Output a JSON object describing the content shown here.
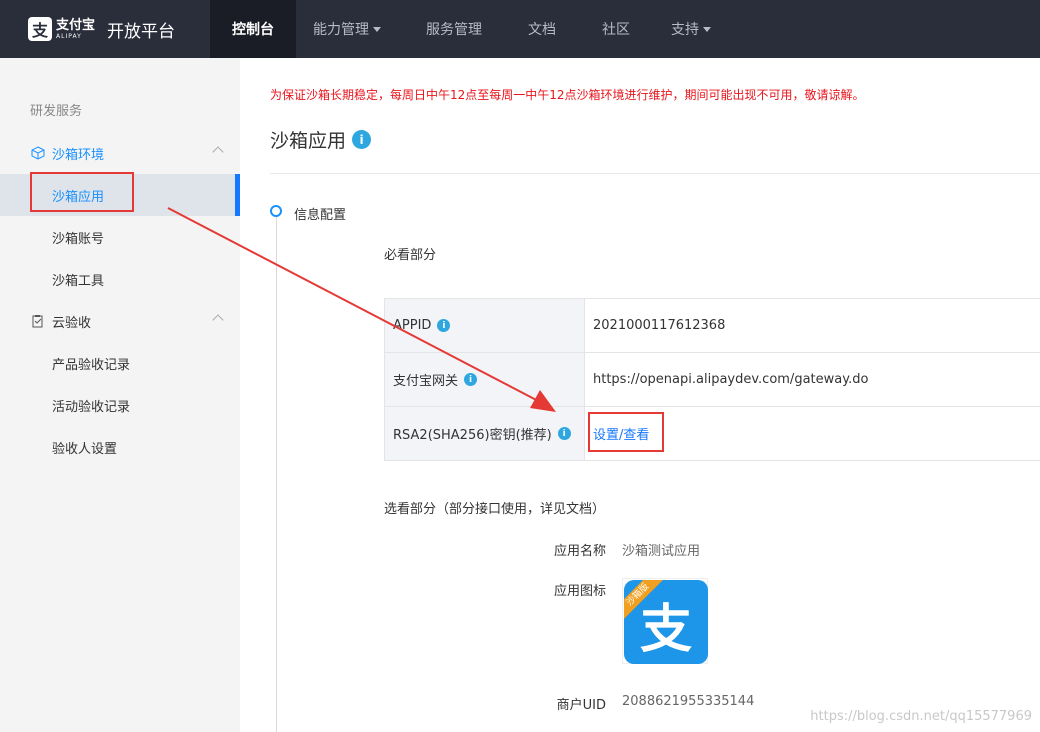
{
  "brand": {
    "logo_glyph": "支",
    "logo_cn": "支付宝",
    "logo_en": "ALIPAY",
    "title": "开放平台"
  },
  "nav": [
    {
      "label": "控制台",
      "active": true,
      "dropdown": false
    },
    {
      "label": "能力管理",
      "active": false,
      "dropdown": true
    },
    {
      "label": "服务管理",
      "active": false,
      "dropdown": false
    },
    {
      "label": "文档",
      "active": false,
      "dropdown": false
    },
    {
      "label": "社区",
      "active": false,
      "dropdown": false
    },
    {
      "label": "支持",
      "active": false,
      "dropdown": true
    }
  ],
  "sidebar": {
    "section": "研发服务",
    "group1": {
      "label": "沙箱环境",
      "icon": "cube-icon"
    },
    "group1_items": [
      "沙箱应用",
      "沙箱账号",
      "沙箱工具"
    ],
    "group2": {
      "label": "云验收",
      "icon": "clipboard-icon"
    },
    "group2_items": [
      "产品验收记录",
      "活动验收记录",
      "验收人设置"
    ]
  },
  "main": {
    "notice": "为保证沙箱长期稳定，每周日中午12点至每周一中午12点沙箱环境进行维护，期间可能出现不可用，敬请谅解。",
    "title": "沙箱应用",
    "info_glyph": "i",
    "step_label": "信息配置",
    "required_heading": "必看部分",
    "config": [
      {
        "key": "APPID",
        "value": "2021000117612368",
        "link": false
      },
      {
        "key": "支付宝网关",
        "value": "https://openapi.alipaydev.com/gateway.do",
        "link": false
      },
      {
        "key": "RSA2(SHA256)密钥(推荐)",
        "value": "设置/查看",
        "link": true
      }
    ],
    "optional_heading": "选看部分（部分接口使用，详见文档）",
    "app_name_label": "应用名称",
    "app_name_value": "沙箱测试应用",
    "app_icon_label": "应用图标",
    "app_icon_ribbon": "沙箱版",
    "app_icon_glyph": "支",
    "merchant_uid_label": "商户UID",
    "merchant_uid_value": "2088621955335144"
  },
  "watermark": "https://blog.csdn.net/qq15577969",
  "colors": {
    "topbar": "#2a2d3a",
    "accent": "#1890ff",
    "notice": "#e8151b",
    "annotation": "#e53935"
  }
}
